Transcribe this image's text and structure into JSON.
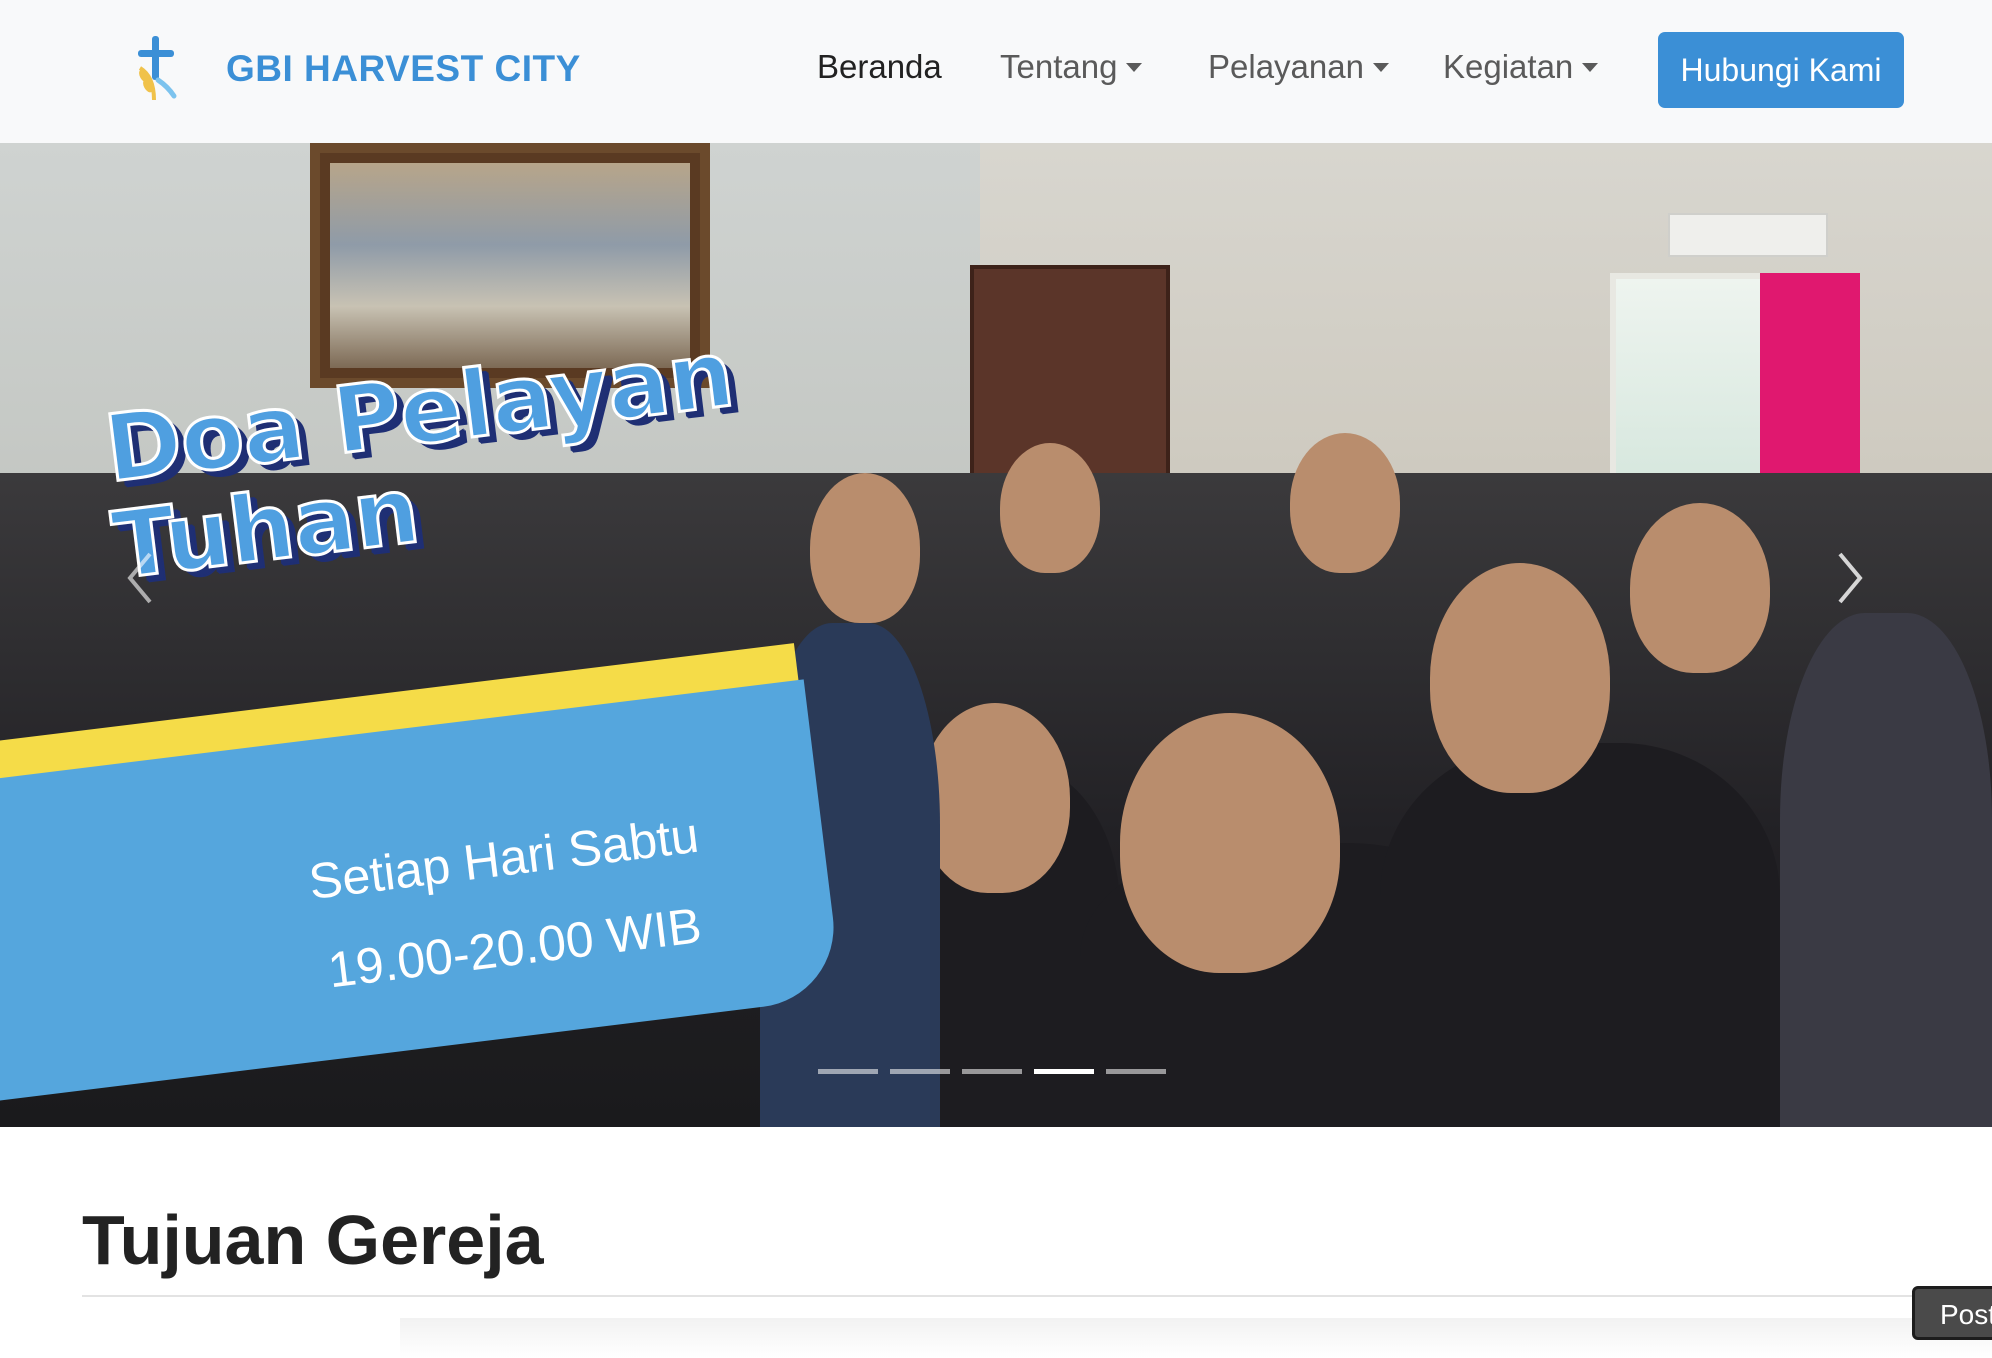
{
  "brand": {
    "name": "GBI HARVEST CITY",
    "logo_icon": "cross-wheat-icon"
  },
  "nav": {
    "items": [
      {
        "label": "Beranda",
        "active": true,
        "dropdown": false
      },
      {
        "label": "Tentang",
        "active": false,
        "dropdown": true
      },
      {
        "label": "Pelayanan",
        "active": false,
        "dropdown": true
      },
      {
        "label": "Kegiatan",
        "active": false,
        "dropdown": true
      }
    ],
    "cta_label": "Hubungi Kami"
  },
  "hero": {
    "headline_line1": "Doa Pelayan",
    "headline_line2": "Tuhan",
    "schedule_day": "Setiap Hari Sabtu",
    "schedule_time": "19.00-20.00 WIB",
    "slide_count": 5,
    "active_slide": 4,
    "prev_icon": "chevron-left-icon",
    "next_icon": "chevron-right-icon"
  },
  "section": {
    "title": "Tujuan Gereja"
  },
  "tooltip": {
    "text": "Post"
  },
  "colors": {
    "brand": "#3b8fd6",
    "navbar_bg": "#f8f9fa",
    "banner_blue": "#55a6dd",
    "banner_yellow": "#f5dc48",
    "headline_shadow": "#1f2f74"
  }
}
